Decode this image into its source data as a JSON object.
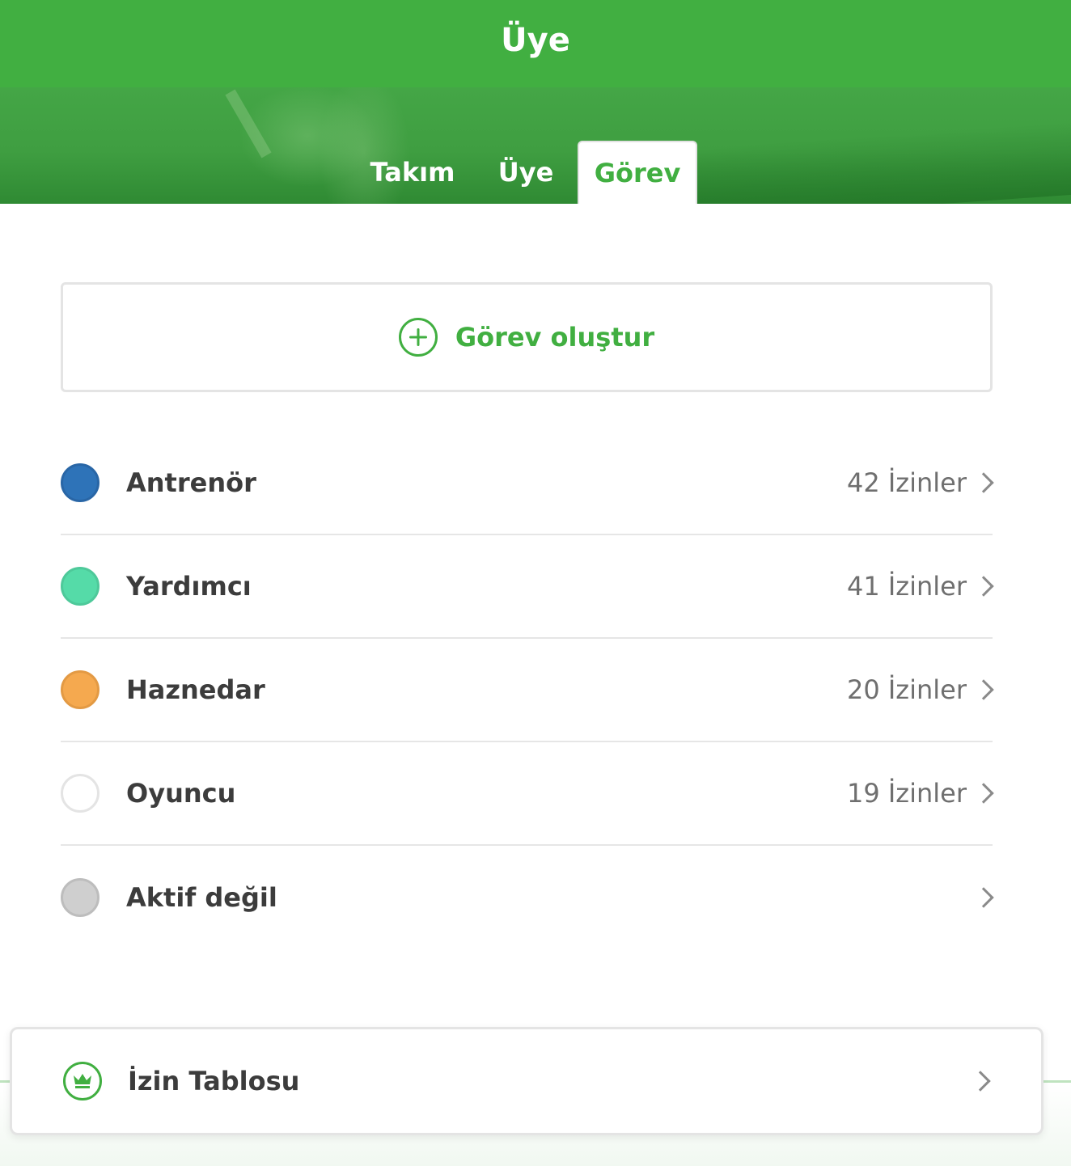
{
  "header": {
    "title": "Üye"
  },
  "tabs": [
    {
      "label": "Takım",
      "active": false
    },
    {
      "label": "Üye",
      "active": false
    },
    {
      "label": "Görev",
      "active": true
    }
  ],
  "create_role": {
    "label": "Görev oluştur",
    "icon": "plus-circle-icon"
  },
  "roles": [
    {
      "name": "Antrenör",
      "count": "42 İzinler",
      "color": "#2e73b8"
    },
    {
      "name": "Yardımcı",
      "count": "41 İzinler",
      "color": "#55dba8"
    },
    {
      "name": "Haznedar",
      "count": "20 İzinler",
      "color": "#f5a94f"
    },
    {
      "name": "Oyuncu",
      "count": "19 İzinler",
      "color": "#ffffff"
    },
    {
      "name": "Aktif değil",
      "count": "",
      "color": "#cfcfcf"
    }
  ],
  "permission_table": {
    "label": "İzin Tablosu",
    "icon": "crown-icon"
  },
  "colors": {
    "accent": "#41af41",
    "divider": "#e6e6e6"
  }
}
